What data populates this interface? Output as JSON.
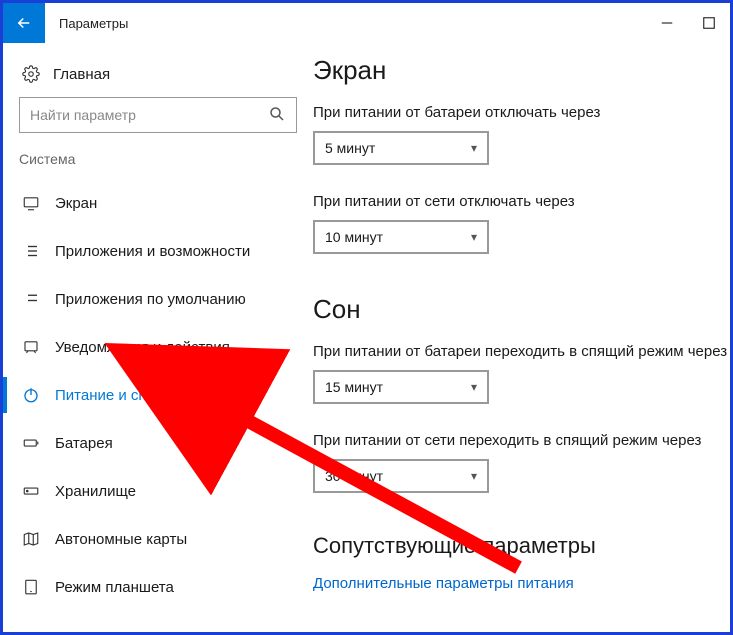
{
  "window": {
    "title": "Параметры"
  },
  "sidebar": {
    "home": "Главная",
    "search_placeholder": "Найти параметр",
    "category": "Система",
    "items": [
      {
        "label": "Экран"
      },
      {
        "label": "Приложения и возможности"
      },
      {
        "label": "Приложения по умолчанию"
      },
      {
        "label": "Уведомления и действия"
      },
      {
        "label": "Питание и спящий режим"
      },
      {
        "label": "Батарея"
      },
      {
        "label": "Хранилище"
      },
      {
        "label": "Автономные карты"
      },
      {
        "label": "Режим планшета"
      }
    ]
  },
  "main": {
    "screen_title": "Экран",
    "battery_off_label": "При питании от батареи отключать через",
    "battery_off_value": "5 минут",
    "ac_off_label": "При питании от сети отключать через",
    "ac_off_value": "10 минут",
    "sleep_title": "Сон",
    "battery_sleep_label": "При питании от батареи переходить в спящий режим через",
    "battery_sleep_value": "15 минут",
    "ac_sleep_label": "При питании от сети переходить в спящий режим через",
    "ac_sleep_value": "30 минут",
    "related_title": "Сопутствующие параметры",
    "related_link": "Дополнительные параметры питания"
  },
  "colors": {
    "accent": "#0078d7",
    "arrow": "#ff0000"
  }
}
